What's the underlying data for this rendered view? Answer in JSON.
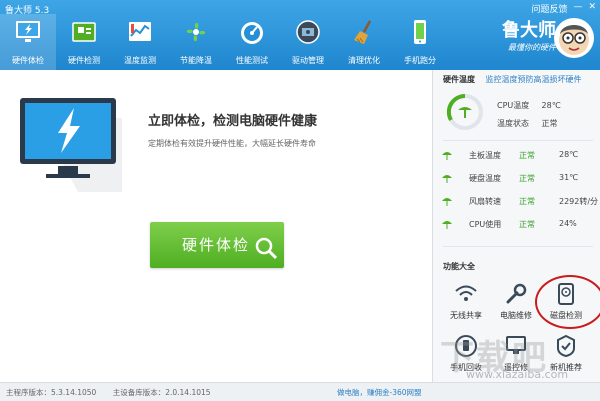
{
  "window": {
    "title": "鲁大师 5.3",
    "controls": [
      "问题反馈",
      "—",
      "✕"
    ]
  },
  "nav": {
    "items": [
      {
        "label": "硬件体检",
        "icon": "pulse-monitor-icon",
        "active": true
      },
      {
        "label": "硬件检测",
        "icon": "circuit-board-icon"
      },
      {
        "label": "温度监测",
        "icon": "thermometer-chart-icon"
      },
      {
        "label": "节能降温",
        "icon": "fan-icon"
      },
      {
        "label": "性能测试",
        "icon": "speedometer-icon"
      },
      {
        "label": "驱动管理",
        "icon": "driver-chip-icon"
      },
      {
        "label": "清理优化",
        "icon": "broom-icon"
      },
      {
        "label": "手机跑分",
        "icon": "smartphone-icon"
      }
    ]
  },
  "brand": {
    "name": "鲁大师",
    "slogan": "最懂你的硬件",
    "avatar_icon": "mascot-avatar-icon"
  },
  "promo": {
    "title": "立即体检，检测电脑硬件健康",
    "description": "定期体检有效提升硬件性能，大幅延长硬件寿命",
    "button_label": "硬件体检",
    "button_icon": "magnifier-icon"
  },
  "side": {
    "header": "硬件温度",
    "header_link": "监控温度预防高温损坏硬件",
    "cpu_temp_label": "CPU温度",
    "cpu_temp_value": "28℃",
    "temp_status_label": "温度状态",
    "temp_status_value": "正常",
    "stats": [
      {
        "label": "主板温度",
        "status": "正常",
        "value": "28℃"
      },
      {
        "label": "硬盘温度",
        "status": "正常",
        "value": "31℃"
      },
      {
        "label": "风扇转速",
        "status": "正常",
        "value": "2292转/分"
      },
      {
        "label": "CPU使用",
        "status": "正常",
        "value": "24%"
      }
    ],
    "tools_title": "功能大全",
    "tools": [
      {
        "label": "无线共享",
        "icon": "wifi-icon"
      },
      {
        "label": "电脑维修",
        "icon": "wrench-icon"
      },
      {
        "label": "磁盘检测",
        "icon": "hard-disk-icon"
      },
      {
        "label": "手机回收",
        "icon": "phone-recycle-icon"
      },
      {
        "label": "遥控修",
        "icon": "remote-repair-icon"
      },
      {
        "label": "新机推荐",
        "icon": "new-device-icon"
      }
    ]
  },
  "status": {
    "main_version": "主程序版本：5.3.14.1050",
    "db_version": "主设备库版本：2.0.14.1015",
    "promo_link": "做电脑，赚佣金-360网盟"
  },
  "watermark": {
    "text": "下载吧",
    "url": "www.xiazaiba.com"
  },
  "colors": {
    "header": "#2590d8",
    "accent_green": "#4fae22",
    "ok_green": "#3aa02a",
    "highlight_circle": "#c81c1c"
  }
}
